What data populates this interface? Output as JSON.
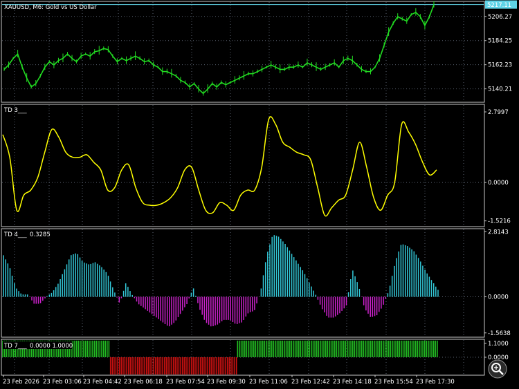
{
  "chart_data": [
    {
      "type": "line",
      "subtype": "candlestick-approx",
      "title": "XAUUSD, M6:  Gold vs US Dollar",
      "current_price": "5217.11",
      "yticks": [
        "5206.27",
        "5184.25",
        "5162.23",
        "5140.21"
      ],
      "ylim": [
        5128,
        5220
      ],
      "series": [
        {
          "values": [
            5158,
            5162,
            5168,
            5172,
            5160,
            5150,
            5142,
            5145,
            5152,
            5160,
            5165,
            5162,
            5166,
            5168,
            5172,
            5168,
            5165,
            5170,
            5172,
            5170,
            5174,
            5175,
            5177,
            5176,
            5170,
            5165,
            5168,
            5166,
            5168,
            5170,
            5168,
            5165,
            5166,
            5162,
            5160,
            5156,
            5156,
            5154,
            5152,
            5148,
            5146,
            5142,
            5145,
            5140,
            5136,
            5140,
            5145,
            5142,
            5146,
            5144,
            5146,
            5148,
            5150,
            5152,
            5154,
            5154,
            5156,
            5158,
            5160,
            5162,
            5160,
            5158,
            5158,
            5160,
            5160,
            5162,
            5160,
            5164,
            5162,
            5160,
            5158,
            5160,
            5162,
            5164,
            5160,
            5166,
            5168,
            5166,
            5162,
            5158,
            5156,
            5156,
            5160,
            5168,
            5180,
            5192,
            5200,
            5206,
            5204,
            5202,
            5208,
            5210,
            5206,
            5198,
            5206,
            5217
          ]
        }
      ]
    },
    {
      "type": "line",
      "label": "TD 3___",
      "yticks": [
        "2.7997",
        "0.0000",
        "-1.5216"
      ],
      "ylim": [
        -1.75,
        3.1
      ],
      "series": [
        {
          "values": [
            1.9,
            1.0,
            -1.1,
            -0.5,
            -0.3,
            0.2,
            1.2,
            2.1,
            1.8,
            1.2,
            1.0,
            1.0,
            1.1,
            0.8,
            0.5,
            -0.3,
            -0.2,
            0.5,
            0.7,
            -0.2,
            -0.8,
            -0.9,
            -0.9,
            -0.8,
            -0.6,
            -0.2,
            0.5,
            0.6,
            -0.3,
            -1.1,
            -1.2,
            -0.8,
            -0.9,
            -1.1,
            -0.5,
            -0.3,
            -0.3,
            0.6,
            2.5,
            2.3,
            1.6,
            1.4,
            1.2,
            1.1,
            0.9,
            -0.2,
            -1.3,
            -1.0,
            -0.7,
            -0.5,
            0.5,
            1.6,
            0.6,
            -0.6,
            -1.1,
            -0.5,
            0.0,
            2.3,
            2.0,
            1.5,
            0.8,
            0.3,
            0.5
          ]
        }
      ]
    },
    {
      "type": "bar",
      "label": "TD 4___",
      "value_label": "0.3285",
      "yticks": [
        "2.8143",
        "0.0000",
        "-1.5638"
      ],
      "ylim": [
        -1.75,
        2.95
      ],
      "values": [
        1.8,
        1.3,
        0.4,
        0.1,
        0.1,
        -0.3,
        -0.3,
        0.0,
        0.2,
        0.6,
        1.2,
        1.8,
        1.9,
        1.5,
        1.4,
        1.5,
        1.3,
        1.0,
        0.3,
        -0.3,
        0.6,
        0.1,
        -0.3,
        -0.5,
        -0.7,
        -0.9,
        -1.1,
        -1.3,
        -1.1,
        -0.7,
        -0.3,
        0.4,
        -0.5,
        -1.1,
        -1.3,
        -1.2,
        -1.0,
        -1.0,
        -1.2,
        -1.1,
        -0.7,
        -0.6,
        0.2,
        1.8,
        2.7,
        2.6,
        2.3,
        1.9,
        1.5,
        1.1,
        0.6,
        0.1,
        -0.5,
        -0.9,
        -0.9,
        -0.7,
        -0.4,
        1.2,
        0.5,
        -0.5,
        -0.9,
        -0.8,
        -0.4,
        0.3,
        1.5,
        2.3,
        2.2,
        2.0,
        1.6,
        1.1,
        0.7,
        0.3
      ]
    },
    {
      "type": "bar",
      "label": "TD 7___",
      "value_label": "0.0000  1.0000",
      "yticks": [
        "1.1000",
        "0.0000"
      ],
      "segments": [
        {
          "from": 0,
          "to": 0.2475,
          "value": 1,
          "color": "#22bb22"
        },
        {
          "from": 0.2475,
          "to": 0.5395,
          "value": -1,
          "color": "#cc1111"
        },
        {
          "from": 0.5395,
          "to": 1,
          "value": 1,
          "color": "#22bb22"
        }
      ]
    }
  ],
  "x_labels": [
    "23 Feb 2026",
    "23 Feb 03:06",
    "23 Feb 04:42",
    "23 Feb 06:18",
    "23 Feb 07:54",
    "23 Feb 09:30",
    "23 Feb 11:06",
    "23 Feb 12:42",
    "23 Feb 14:18",
    "23 Feb 15:54",
    "23 Feb 17:30"
  ],
  "colors": {
    "background": "#000000",
    "price": "#22dd22",
    "td3": "#ffff00",
    "td4_positive": "#33c8d8",
    "td4_negative": "#cc22cc",
    "td7_up": "#22bb22",
    "td7_down": "#cc1111",
    "grid": "#5a6270",
    "current_price_tag": "#5fd3e6"
  },
  "zoom_icon": "zoom-icon"
}
